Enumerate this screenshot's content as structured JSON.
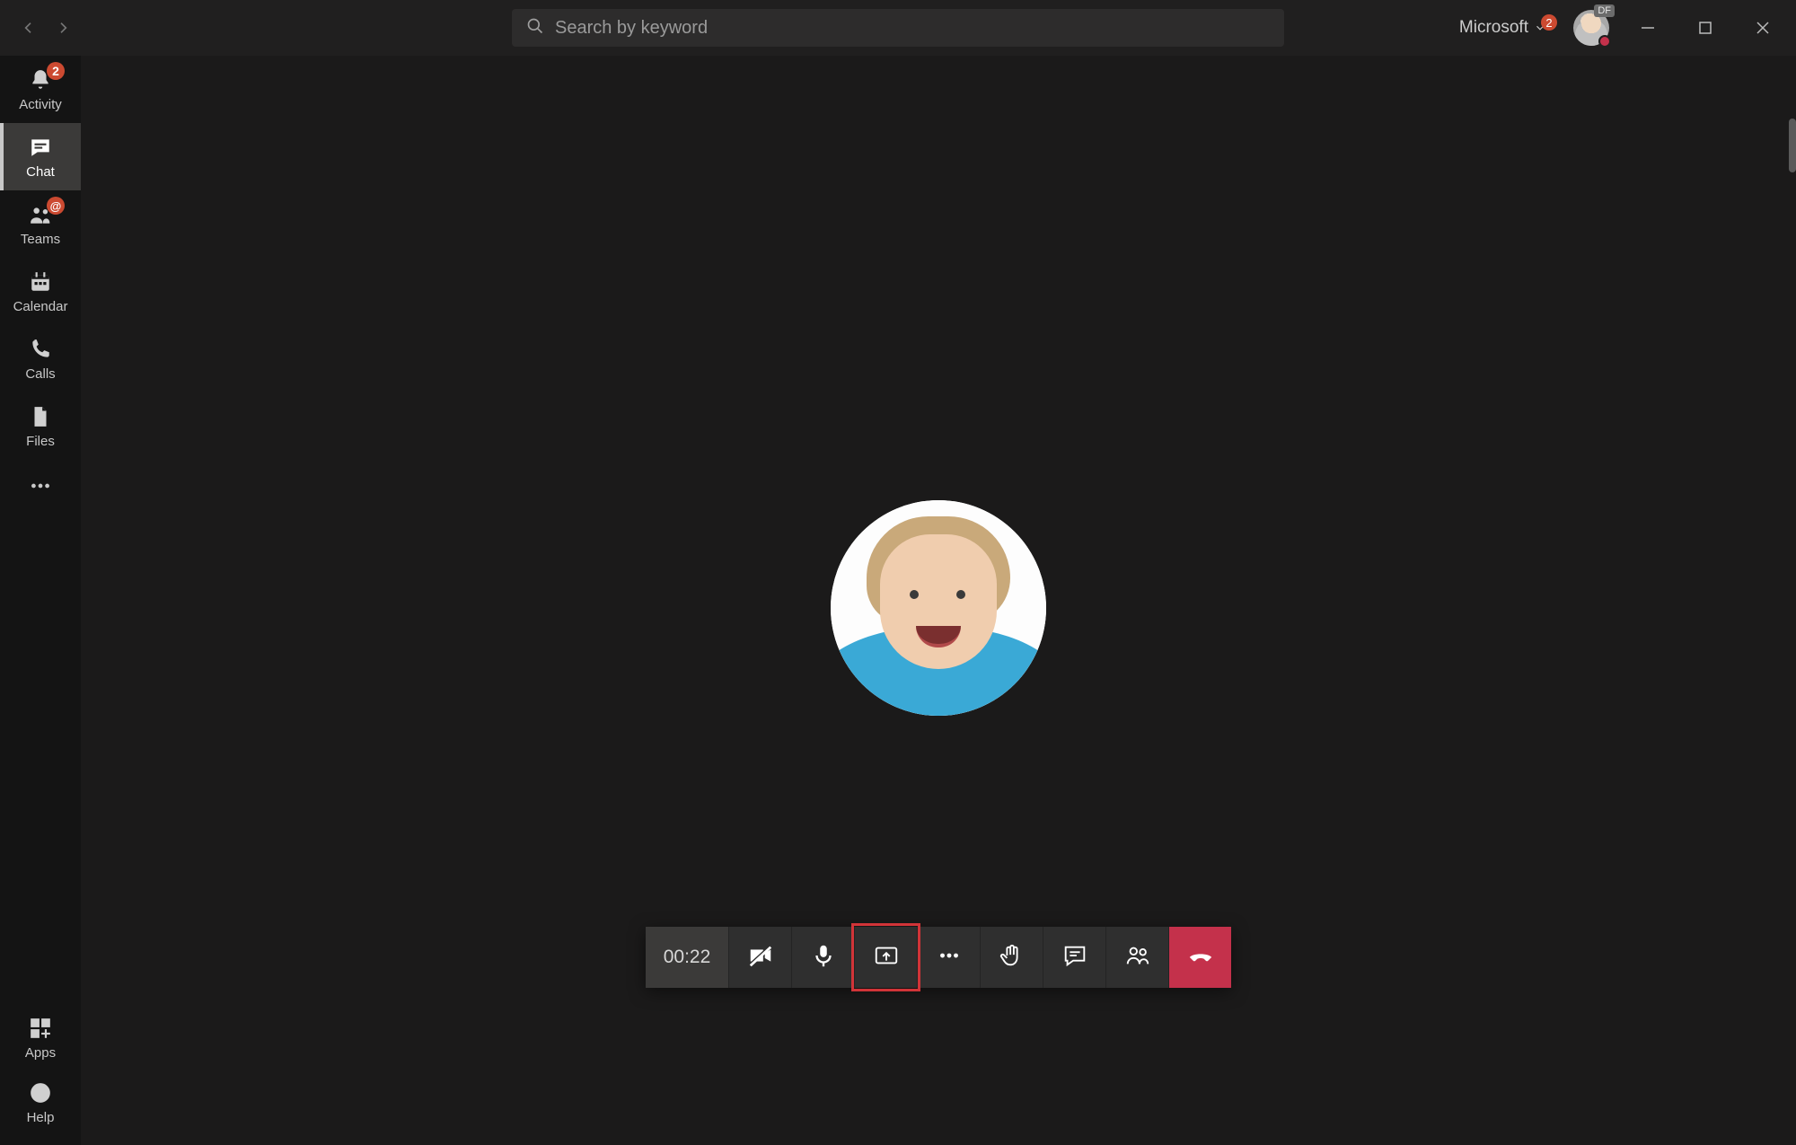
{
  "topbar": {
    "search_placeholder": "Search by keyword",
    "tenant_name": "Microsoft",
    "tenant_badge": "2",
    "avatar_initials": "DF"
  },
  "left_rail": {
    "activity": {
      "label": "Activity",
      "badge": "2"
    },
    "chat": {
      "label": "Chat"
    },
    "teams": {
      "label": "Teams",
      "badge": "@"
    },
    "calendar": {
      "label": "Calendar"
    },
    "calls": {
      "label": "Calls"
    },
    "files": {
      "label": "Files"
    },
    "apps": {
      "label": "Apps"
    },
    "help": {
      "label": "Help"
    }
  },
  "call": {
    "duration": "00:22"
  }
}
